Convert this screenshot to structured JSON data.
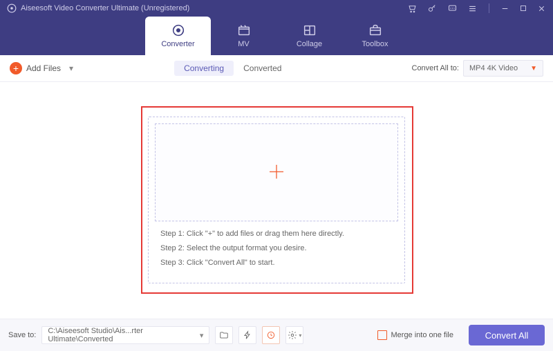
{
  "titlebar": {
    "title": "Aiseesoft Video Converter Ultimate (Unregistered)"
  },
  "nav": {
    "tabs": [
      {
        "label": "Converter"
      },
      {
        "label": "MV"
      },
      {
        "label": "Collage"
      },
      {
        "label": "Toolbox"
      }
    ]
  },
  "toolbar": {
    "add_files_label": "Add Files",
    "seg_converting": "Converting",
    "seg_converted": "Converted",
    "convert_all_to_label": "Convert All to:",
    "convert_all_to_value": "MP4 4K Video"
  },
  "dropzone": {
    "step1": "Step 1: Click \"+\" to add files or drag them here directly.",
    "step2": "Step 2: Select the output format you desire.",
    "step3": "Step 3: Click \"Convert All\" to start."
  },
  "footer": {
    "save_to_label": "Save to:",
    "save_to_value": "C:\\Aiseesoft Studio\\Ais...rter Ultimate\\Converted",
    "merge_label": "Merge into one file",
    "convert_all_button": "Convert All"
  }
}
